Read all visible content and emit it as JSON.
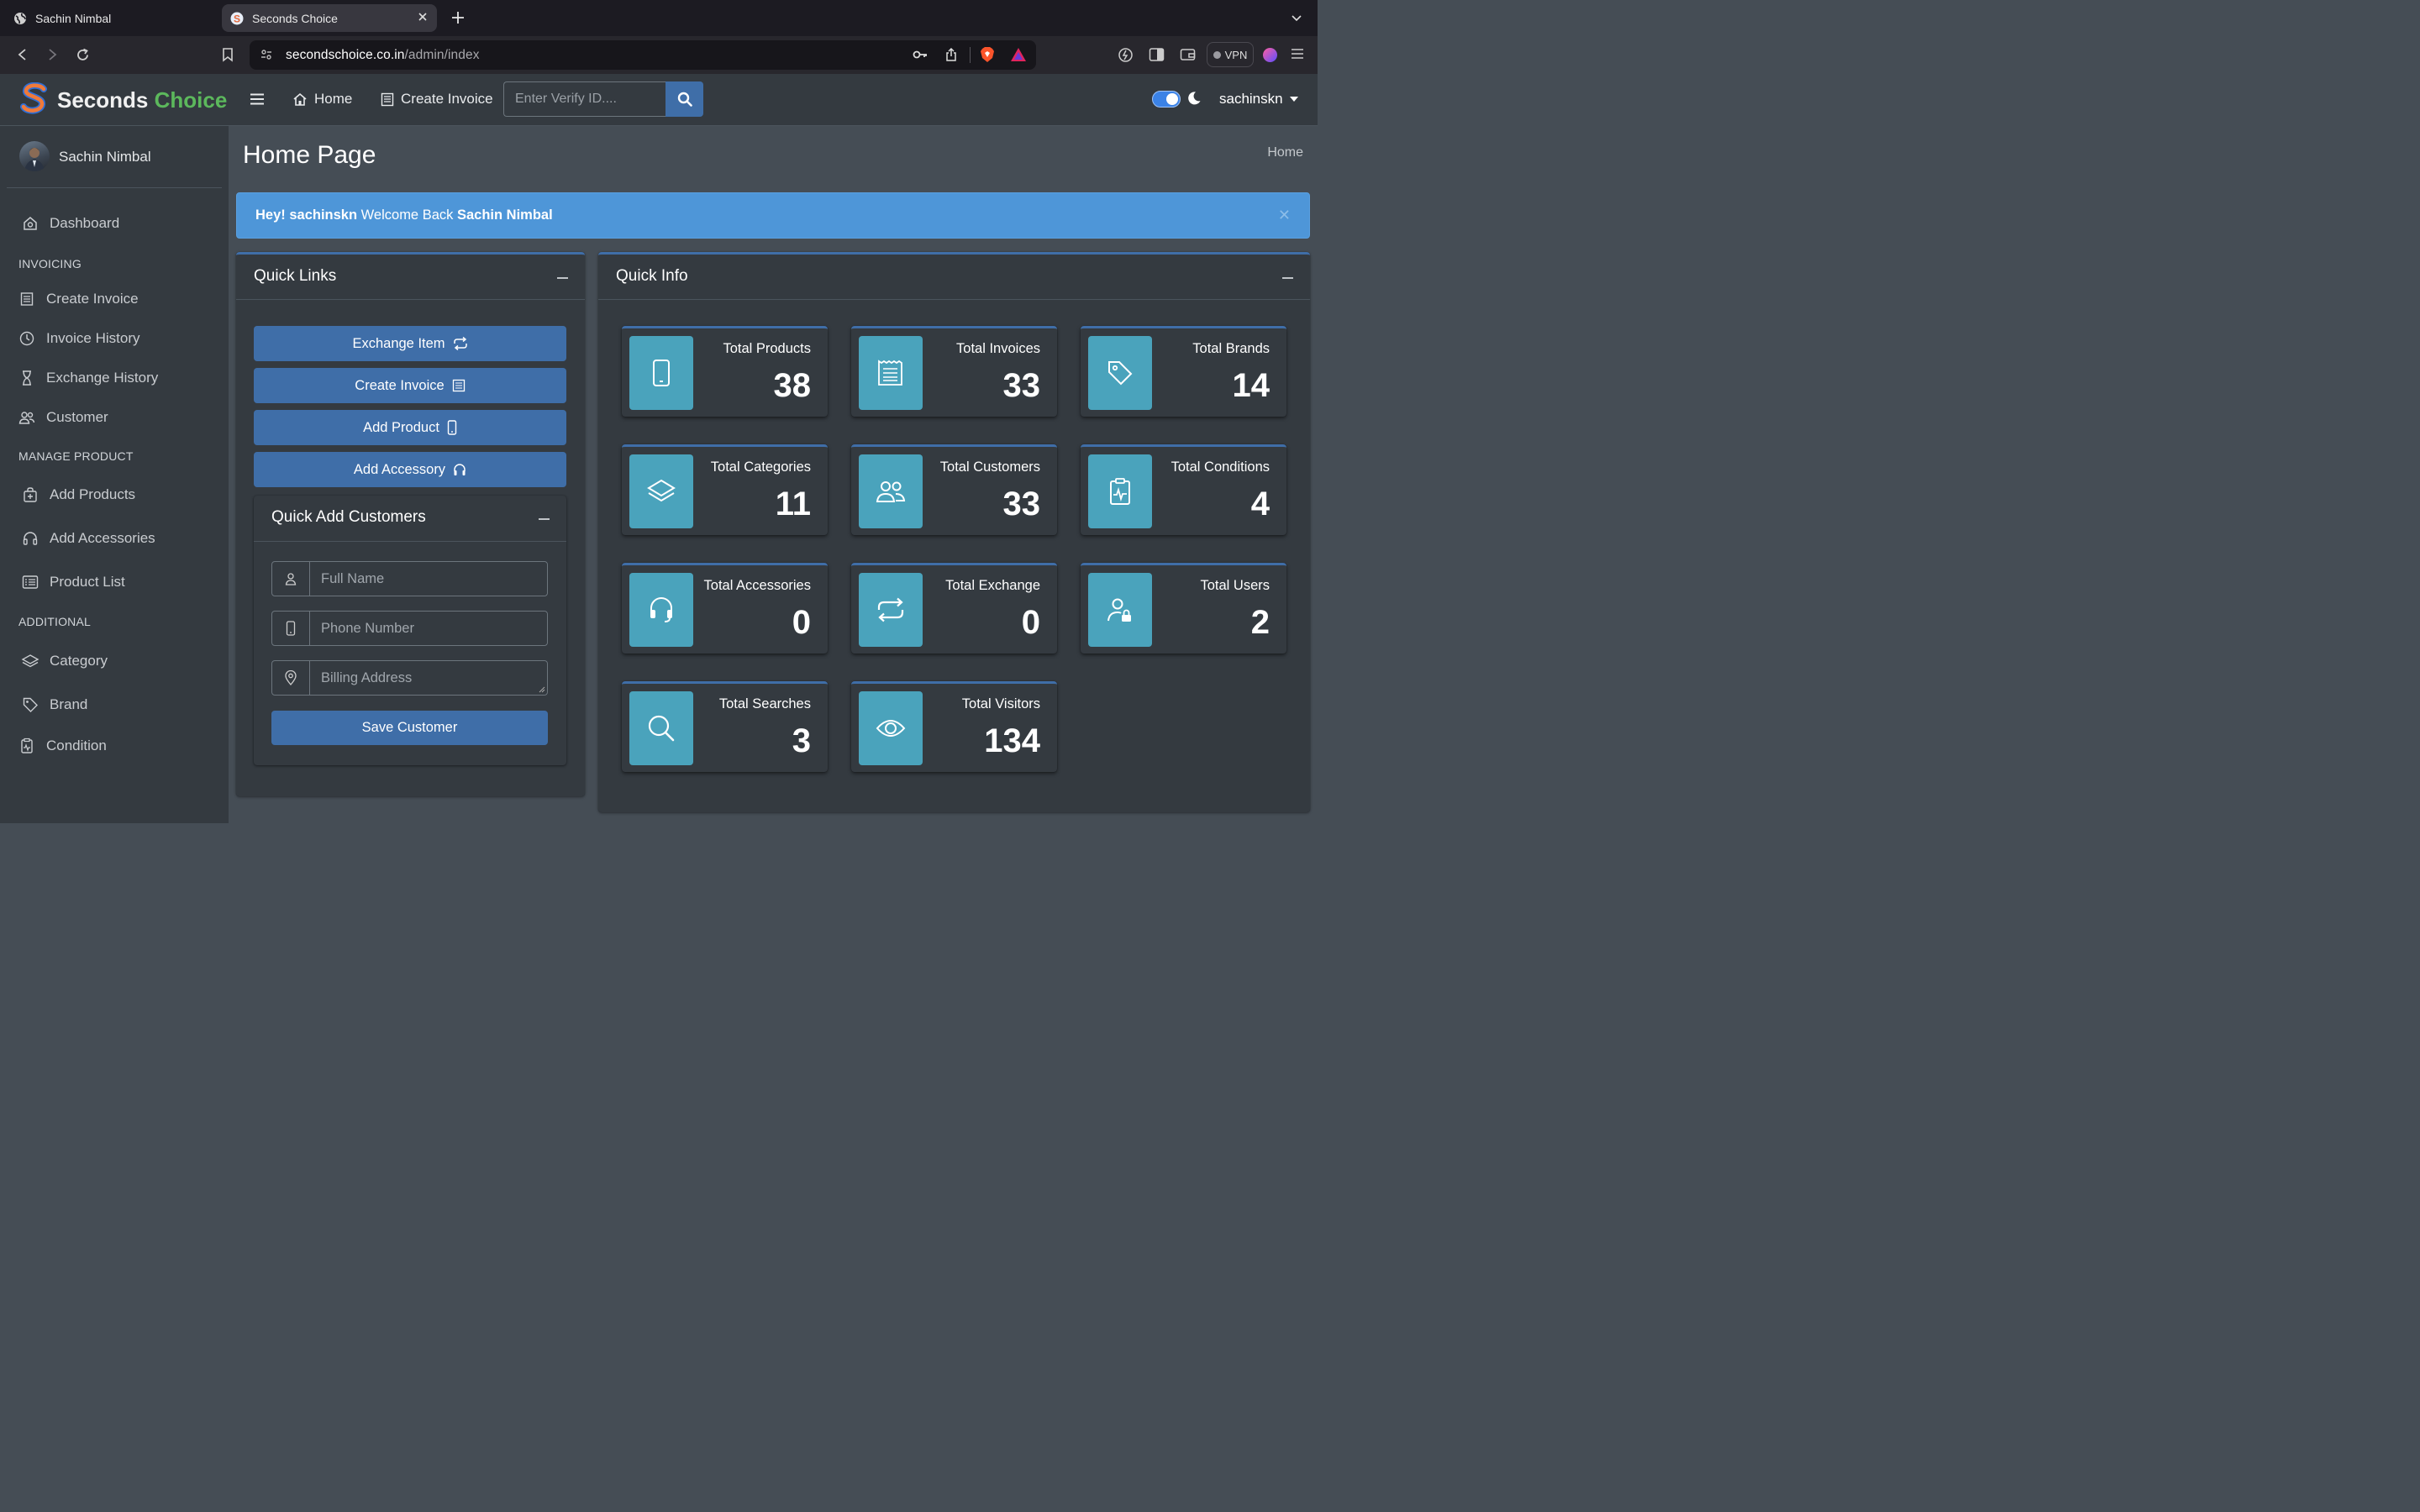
{
  "browser": {
    "tabs": [
      {
        "title": "Sachin Nimbal"
      },
      {
        "title": "Seconds Choice"
      }
    ],
    "url_host": "secondschoice.co.in",
    "url_path": "/admin/index",
    "vpn_label": "VPN"
  },
  "brand": {
    "name_1": "Seconds",
    "name_2": "Choice",
    "accent": "#5cb85c"
  },
  "user": {
    "name": "Sachin Nimbal"
  },
  "sidebar": {
    "dashboard": "Dashboard",
    "h_invoicing": "INVOICING",
    "create_invoice": "Create Invoice",
    "invoice_history": "Invoice History",
    "exchange_history": "Exchange History",
    "customer": "Customer",
    "h_manage": "MANAGE PRODUCT",
    "add_products": "Add Products",
    "add_accessories": "Add Accessories",
    "product_list": "Product List",
    "h_additional": "ADDITIONAL",
    "category": "Category",
    "brand": "Brand",
    "condition": "Condition"
  },
  "topnav": {
    "home": "Home",
    "create_invoice": "Create Invoice",
    "search_placeholder": "Enter Verify ID....",
    "account": "sachinskn"
  },
  "page": {
    "title": "Home Page",
    "breadcrumb": "Home"
  },
  "alert": {
    "hey": "Hey! sachinskn",
    "welcome": " Welcome Back ",
    "name": "Sachin Nimbal"
  },
  "quick_links": {
    "title": "Quick Links",
    "exchange_item": "Exchange Item",
    "create_invoice": "Create Invoice",
    "add_product": "Add Product",
    "add_accessory": "Add Accessory"
  },
  "quick_add": {
    "title": "Quick Add Customers",
    "full_name_placeholder": "Full Name",
    "phone_placeholder": "Phone Number",
    "address_placeholder": "Billing Address",
    "save": "Save Customer"
  },
  "quick_info": {
    "title": "Quick Info",
    "stats": [
      {
        "label": "Total Products",
        "value": "38",
        "icon": "phone-icon"
      },
      {
        "label": "Total Invoices",
        "value": "33",
        "icon": "receipt-icon"
      },
      {
        "label": "Total Brands",
        "value": "14",
        "icon": "tag-icon"
      },
      {
        "label": "Total Categories",
        "value": "11",
        "icon": "layers-icon"
      },
      {
        "label": "Total Customers",
        "value": "33",
        "icon": "people-icon"
      },
      {
        "label": "Total Conditions",
        "value": "4",
        "icon": "clipboard-pulse-icon"
      },
      {
        "label": "Total Accessories",
        "value": "0",
        "icon": "headset-icon"
      },
      {
        "label": "Total Exchange",
        "value": "0",
        "icon": "repeat-icon"
      },
      {
        "label": "Total Users",
        "value": "2",
        "icon": "user-lock-icon"
      },
      {
        "label": "Total Searches",
        "value": "3",
        "icon": "search-icon"
      },
      {
        "label": "Total Visitors",
        "value": "134",
        "icon": "eye-icon"
      }
    ]
  }
}
